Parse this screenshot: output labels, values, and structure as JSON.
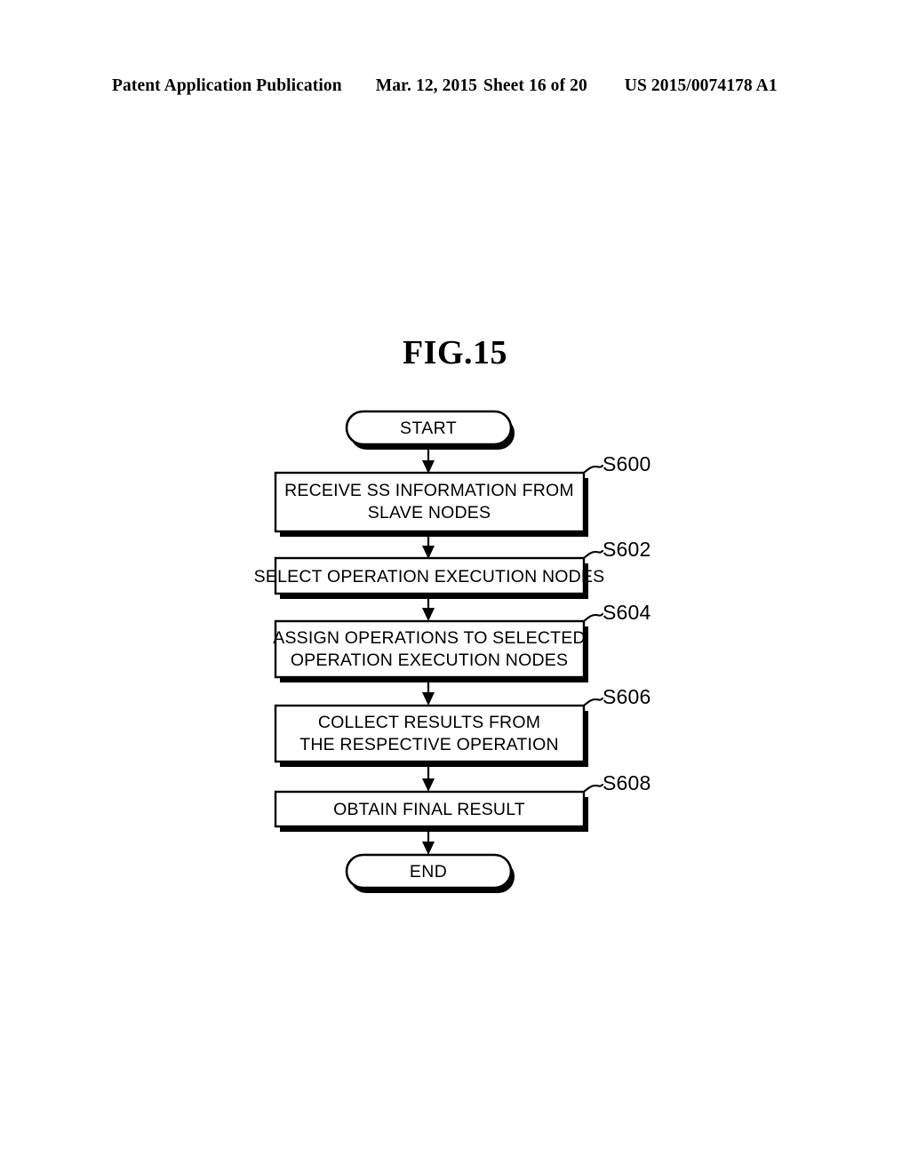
{
  "header": {
    "left": "Patent Application Publication",
    "date": "Mar. 12, 2015",
    "sheet": "Sheet 16 of 20",
    "publication_number": "US 2015/0074178 A1"
  },
  "figure": {
    "title": "FIG.15",
    "type": "flowchart",
    "start_label": "START",
    "end_label": "END",
    "steps": [
      {
        "ref": "S600",
        "lines": [
          "RECEIVE SS INFORMATION FROM",
          "SLAVE NODES"
        ]
      },
      {
        "ref": "S602",
        "lines": [
          "SELECT OPERATION EXECUTION NODES"
        ]
      },
      {
        "ref": "S604",
        "lines": [
          "ASSIGN OPERATIONS TO SELECTED",
          "OPERATION EXECUTION NODES"
        ]
      },
      {
        "ref": "S606",
        "lines": [
          "COLLECT RESULTS FROM",
          "THE RESPECTIVE  OPERATION"
        ]
      },
      {
        "ref": "S608",
        "lines": [
          "OBTAIN FINAL RESULT"
        ]
      }
    ]
  },
  "colors": {
    "ink": "#000000",
    "paper": "#ffffff"
  }
}
